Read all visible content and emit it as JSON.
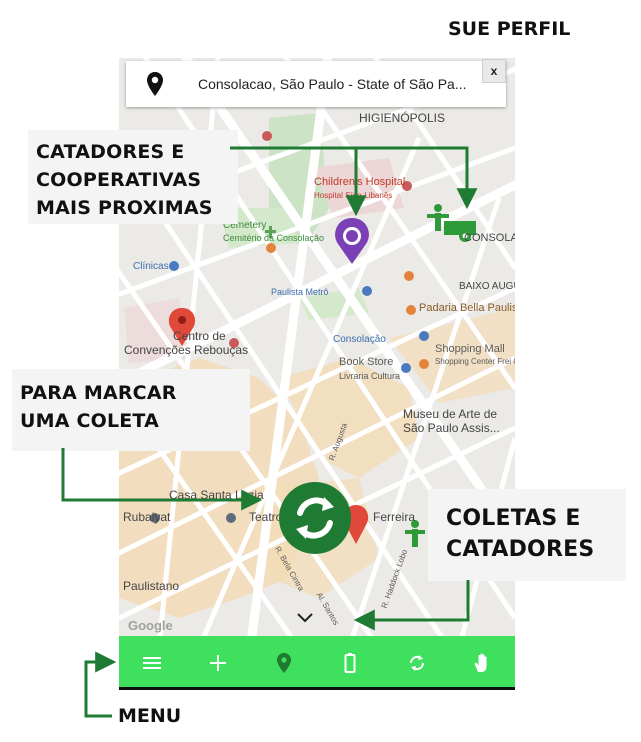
{
  "header": {
    "profile_label": "SUE PERFIL"
  },
  "search": {
    "location_text": "Consolacao, São Paulo - State of São Pa...",
    "close_label": "x"
  },
  "map": {
    "labels": [
      "HIGIENÓPOLIS",
      "Children's Hospital",
      "Hospital Sírio-Libanês",
      "Cemetery",
      "Cemitério da Consolação",
      "CONSOLAÇÃO",
      "Clínicas",
      "Paulista Metrô",
      "BAIXO AUGUSTA",
      "Padaria Bella Paulista",
      "Centro de",
      "Convenções Rebouças",
      "Consolação",
      "Shopping Mall",
      "Shopping Center Frei Caneca",
      "Book Store",
      "Livraria Cultura",
      "Museu de Arte de",
      "São Paulo Assis...",
      "Casa Santa Luzia",
      "Rubaiyat",
      "Teatro",
      "Ferreira",
      "Paulistano",
      "R. Augusta",
      "R. Bela Cintra",
      "R. Haddock Lobo",
      "Al. Santos"
    ],
    "google_label": "Google"
  },
  "callouts": {
    "catadores": [
      "CATADORES E",
      "COOPERATIVAS",
      "MAIS PROXIMAS"
    ],
    "marcar": [
      "PARA MARCAR",
      "UMA COLETA"
    ],
    "coletas": [
      "COLETAS E",
      "CATADORES"
    ],
    "menu": "MENU"
  },
  "bottom_bar": {
    "items": [
      "menu-icon",
      "plus-icon",
      "location-pin-icon",
      "battery-icon",
      "refresh-icon",
      "hand-icon"
    ]
  },
  "colors": {
    "accent_green": "#3fe05d",
    "recycle_green": "#1f7a33",
    "pin_red": "#e0483a",
    "pin_purple": "#7b3fb6"
  }
}
